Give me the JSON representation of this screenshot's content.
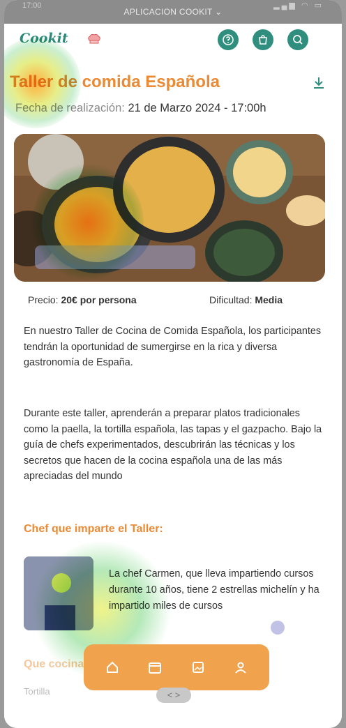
{
  "status_bar": {
    "time": "17:00",
    "app_title": "APLICACION COOKIT"
  },
  "header": {
    "logo_text": "Cookit",
    "icons": [
      "chef-hat-icon",
      "help-icon",
      "cart-icon",
      "search-icon"
    ]
  },
  "event": {
    "title": "Taller de comida Española",
    "date_label": "Fecha de realización:",
    "date_value": "21 de Marzo 2024 - 17:00h",
    "price_label": "Precio:",
    "price_value": "20€ por persona",
    "difficulty_label": "Dificultad:",
    "difficulty_value": "Media",
    "description_1": "En nuestro Taller de Cocina de Comida Española, los participantes  tendrán la oportunidad de sumergirse en la rica y diversa gastronomía de España.",
    "description_2": "Durante este taller, aprenderán a preparar platos tradicionales  como la paella, la tortilla española, las tapas y el gazpacho. Bajo la  guía de chefs experimentados, descubrirán las técnicas y los secretos  que hacen de la cocina española una de las más apreciadas del mundo"
  },
  "chef_section": {
    "heading": "Chef que imparte el Taller:",
    "description": "La chef Carmen, que lleva impartiendo cursos durante 10 años, tiene 2 estrellas michelín y ha impartido miles de cursos"
  },
  "next_section": {
    "heading": "Que cocinaremos",
    "first_item": "Tortilla"
  },
  "bottom_nav": {
    "items": [
      "home-icon",
      "calendar-icon",
      "gallery-icon",
      "profile-icon"
    ]
  },
  "gesture_pill": {
    "label": "< >"
  },
  "colors": {
    "accent_orange": "#ea8a35",
    "brand_teal": "#2f8e7e",
    "nav_orange": "#f1a24c"
  }
}
